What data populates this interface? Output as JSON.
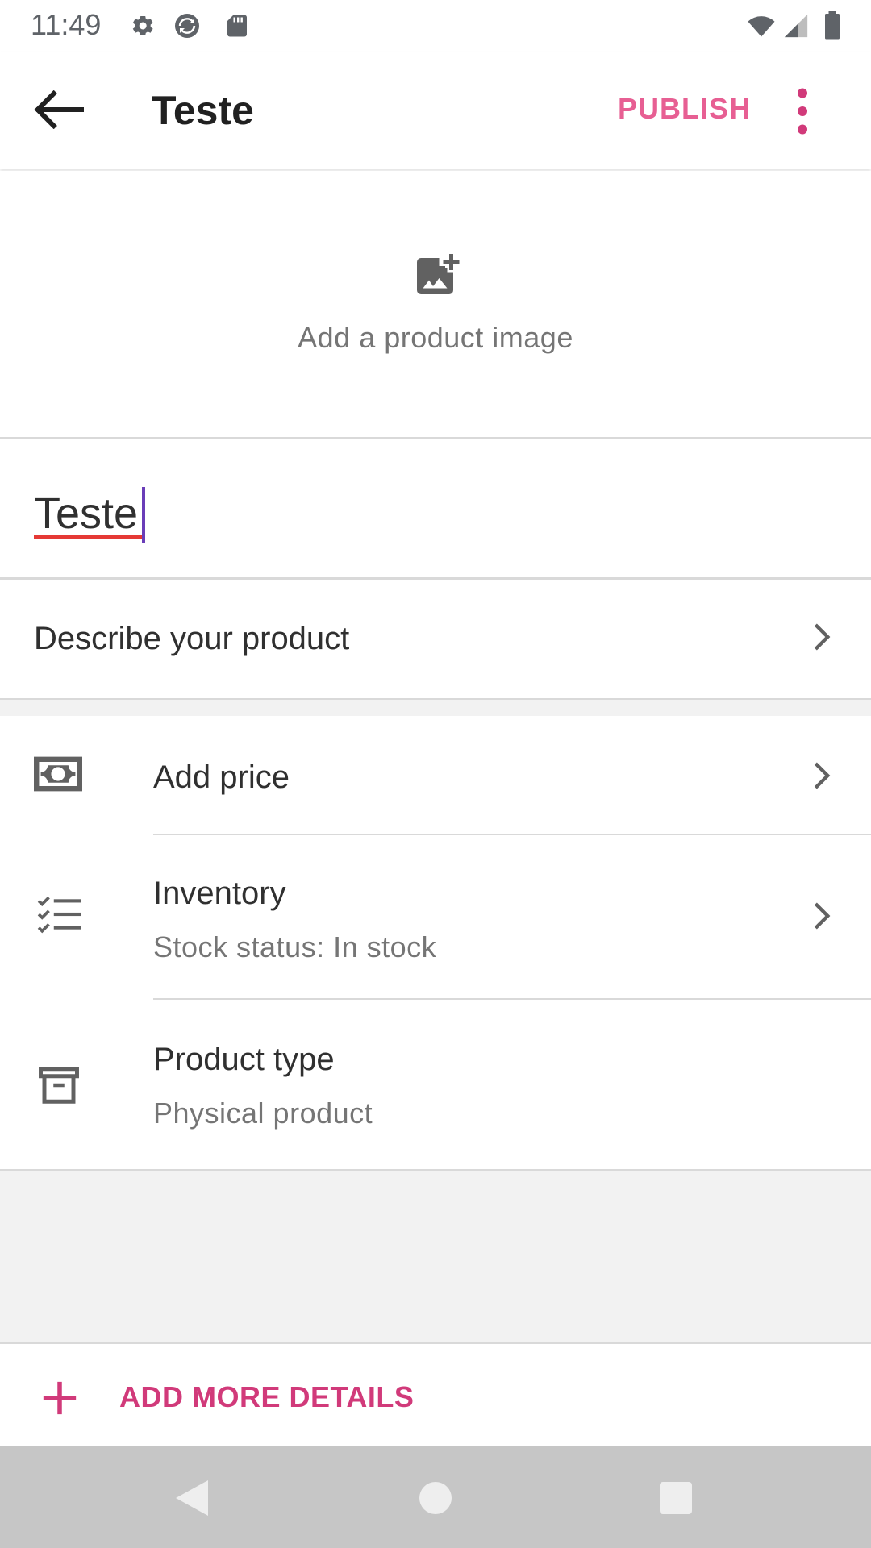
{
  "status_bar": {
    "time": "11:49",
    "left_icons": [
      "settings-gear-icon",
      "sync-icon",
      "sd-card-icon"
    ],
    "right_icons": [
      "wifi-icon",
      "cell-signal-icon",
      "battery-icon"
    ]
  },
  "app_bar": {
    "title": "Teste",
    "publish_label": "PUBLISH",
    "accent_color": "#e75f93"
  },
  "image_section": {
    "label": "Add a product image",
    "icon": "add-photo-icon"
  },
  "product_name": {
    "value": "Teste"
  },
  "description": {
    "label": "Describe your product"
  },
  "list": {
    "price": {
      "title": "Add price",
      "icon": "money-icon"
    },
    "inventory": {
      "title": "Inventory",
      "subtitle": "Stock status: In stock",
      "icon": "checklist-icon"
    },
    "product_type": {
      "title": "Product type",
      "subtitle": "Physical product",
      "icon": "archive-box-icon"
    }
  },
  "footer": {
    "add_more_label": "ADD MORE DETAILS",
    "accent_color": "#d13a7a"
  }
}
